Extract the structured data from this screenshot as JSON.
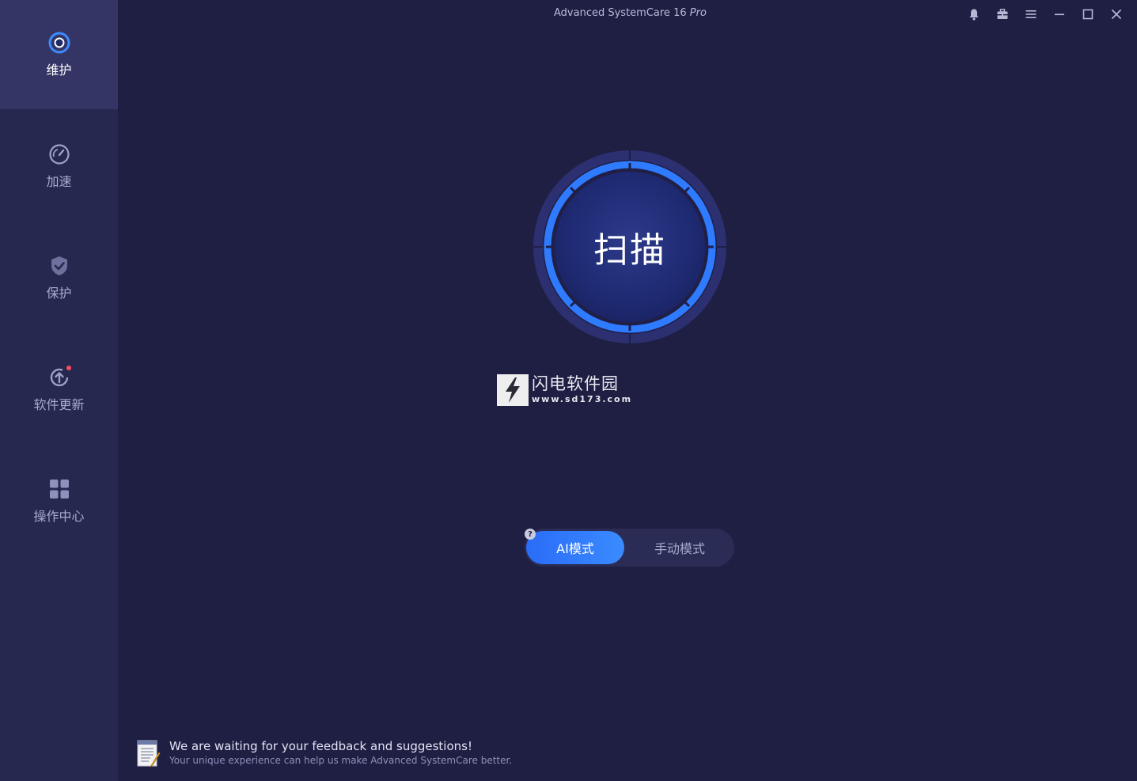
{
  "app": {
    "title": "Advanced SystemCare",
    "version": "16",
    "edition": "Pro"
  },
  "sidebar": {
    "items": [
      {
        "label": "维护",
        "icon": "maintenance-icon",
        "active": true
      },
      {
        "label": "加速",
        "icon": "speedometer-icon",
        "active": false
      },
      {
        "label": "保护",
        "icon": "shield-icon",
        "active": false
      },
      {
        "label": "软件更新",
        "icon": "update-icon",
        "active": false,
        "badge": true
      },
      {
        "label": "操作中心",
        "icon": "grid-icon",
        "active": false
      }
    ]
  },
  "window_controls": [
    "bell-icon",
    "toolbox-icon",
    "menu-icon",
    "minimize-icon",
    "maximize-icon",
    "close-icon"
  ],
  "main": {
    "scan_button_label": "扫描",
    "watermark": {
      "title": "闪电软件园",
      "url": "www.sd173.com"
    },
    "mode_switch": {
      "help": "?",
      "ai_label": "AI模式",
      "manual_label": "手动模式",
      "selected": "AI模式"
    }
  },
  "feedback": {
    "title": "We are waiting for your feedback and suggestions!",
    "subtitle": "Your unique experience can help us make Advanced SystemCare better."
  },
  "colors": {
    "background": "#1f1f44",
    "sidebar": "#27284f",
    "sidebar_active": "#343565",
    "accent": "#2f7bff",
    "badge": "#ff4a5a"
  }
}
